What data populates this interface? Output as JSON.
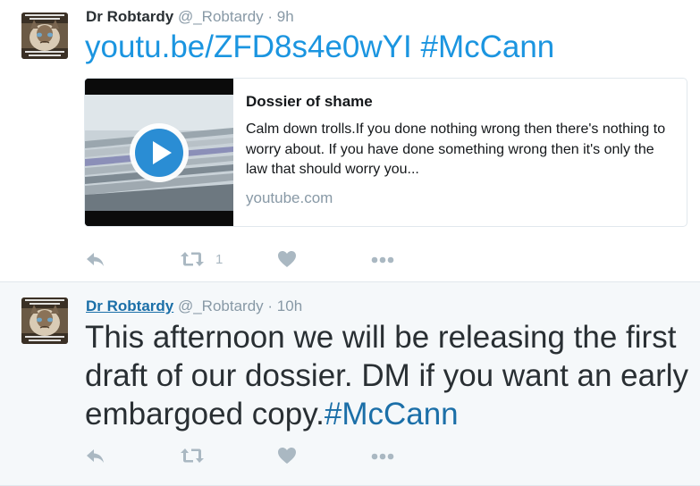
{
  "tweets": [
    {
      "name": "Dr Robtardy",
      "handle": "@_Robtardy",
      "time": " · 9h",
      "link": "youtu.be/ZFD8s4e0wYI",
      "hashtag": "#McCann",
      "card": {
        "title": "Dossier of shame",
        "description": "Calm down trolls.If you done nothing wrong then there's nothing to worry about. If you have done something wrong then it's only the law that should worry you...",
        "domain": "youtube.com"
      },
      "retweet_count": "1"
    },
    {
      "name": "Dr Robtardy",
      "handle": "@_Robtardy",
      "time": " · 10h",
      "text_line1": "This afternoon we will be releasing the first",
      "text_line2": "draft of our dossier. DM if you want an early",
      "text_line3": "embargoed copy.",
      "hashtag": "#McCann"
    }
  ],
  "icons": {
    "reply": "reply-icon",
    "retweet": "retweet-icon",
    "like": "heart-icon",
    "more": "more-dots-icon",
    "play": "play-icon",
    "avatar": "grumpy-cat-avatar"
  },
  "colors": {
    "link": "#1b95e0",
    "hashtag": "#1b6fa8",
    "muted": "#8899a6",
    "action_icon": "#aab8c2",
    "selected_bg": "#f5f8fa"
  }
}
